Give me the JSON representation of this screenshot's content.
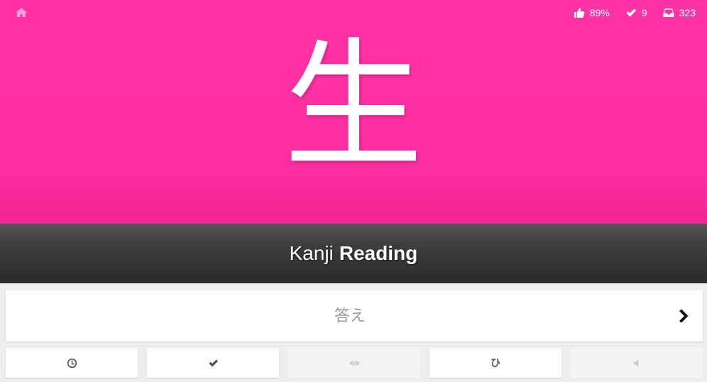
{
  "header": {
    "home_icon": "home-icon",
    "stats": {
      "percent_correct": "89%",
      "completed": "9",
      "remaining": "323"
    },
    "colors": {
      "background": "#ff2fa3",
      "text": "#ffffff"
    }
  },
  "item": {
    "character": "生"
  },
  "question_type": {
    "category": "Kanji",
    "type": "Reading",
    "background": "#333333"
  },
  "answer": {
    "value": "",
    "placeholder": "答え",
    "submit_icon": "chevron-right-icon"
  },
  "additional_buttons": [
    {
      "icon": "clock-icon",
      "enabled": true
    },
    {
      "icon": "check-icon",
      "enabled": true
    },
    {
      "icon": "eye-icon",
      "enabled": false
    },
    {
      "icon": "hiragana-hi",
      "label": "ひ",
      "enabled": true
    },
    {
      "icon": "speaker-icon",
      "enabled": false
    }
  ]
}
